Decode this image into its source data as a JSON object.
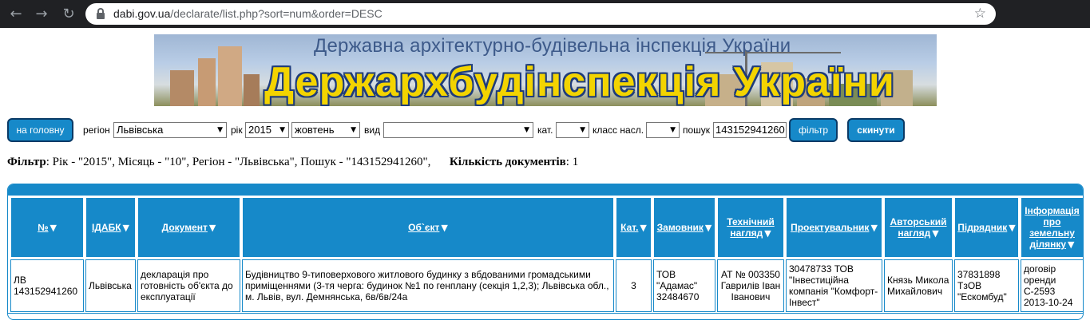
{
  "browser": {
    "url_host": "dabi.gov.ua",
    "url_path": "/declarate/list.php?sort=num&order=DESC"
  },
  "banner": {
    "subtitle": "Державна архітектурно-будівельна інспекція України",
    "title": "Держархбудінспекція України"
  },
  "toolbar": {
    "home_button": "на головну",
    "region_label": "регіон",
    "region_value": "Львівська",
    "year_label": "рік",
    "year_value": "2015",
    "month_value": "жовтень",
    "type_label": "вид",
    "type_value": "",
    "cat_label": "кат.",
    "cat_value": "",
    "class_label": "класс насл.",
    "class_value": "",
    "search_label": "пошук",
    "search_value": "143152941260",
    "filter_button": "фільтр",
    "reset_button": "скинути"
  },
  "filter_summary": {
    "label": "Фільтр",
    "text": ": Рік - \"2015\", Місяць - \"10\", Регіон - \"Львівська\", Пошук - \"143152941260\",",
    "count_label": "Кількість документів",
    "count_value": ": 1"
  },
  "table": {
    "headers": [
      "№",
      "ІДАБК",
      "Документ",
      "Об`єкт",
      "Кат.",
      "Замовник",
      "Технічний нагляд",
      "Проектувальник",
      "Авторський нагляд",
      "Підрядник",
      "Інформація про земельну ділянку"
    ],
    "rows": [
      {
        "num": "ЛВ 143152941260",
        "idabk": "Львівська",
        "document": "декларація про готовність об'єкта до експлуатації",
        "object": "Будівництво 9-типоверхового житлового будинку з вбдованими громадськими приміщеннями (3-тя черга: будинок №1 по генплану (секція 1,2,3); Львівська обл., м. Львів, вул. Демнянська, 6в/6в/24а",
        "cat": "3",
        "customer": "ТОВ \"Адамас\" 32484670",
        "tech_supervision": "АТ № 003350 Гаврилів Іван Іванович",
        "designer": "30478733 ТОВ \"Інвестиційна компанія \"Комфорт-Інвест\"",
        "author_supervision": "Князь Микола Михайлович",
        "contractor": "37831898 ТзОВ \"Ескомбуд\"",
        "land_info": "договір оренди С-2593 2013-10-24"
      }
    ]
  },
  "colors": {
    "accent": "#1689c9",
    "button_border": "#0a3a66",
    "banner_title": "#f3d400"
  }
}
